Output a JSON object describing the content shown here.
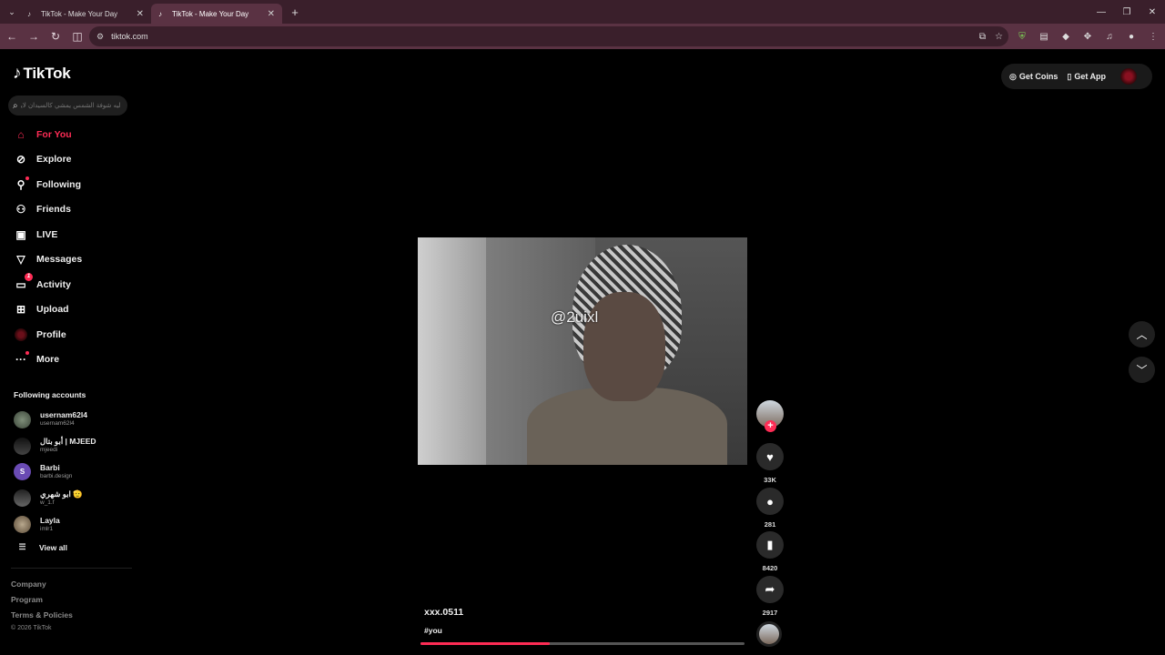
{
  "browser": {
    "tabs": [
      {
        "title": "TikTok - Make Your Day",
        "active": false
      },
      {
        "title": "TikTok - Make Your Day",
        "active": true
      }
    ],
    "new_tab_symbol": "+",
    "address": "tiktok.com",
    "window_controls": {
      "minimize": "—",
      "maximize": "❐",
      "close": "✕"
    }
  },
  "logo": {
    "text": "TikTok",
    "icon": "tiktok-note-icon"
  },
  "search": {
    "placeholder": "ليه شوفة الشمس يمشي كالسيدان لايوه..."
  },
  "nav": [
    {
      "label": "For You",
      "icon": "home-icon",
      "active": true
    },
    {
      "label": "Explore",
      "icon": "compass-icon"
    },
    {
      "label": "Following",
      "icon": "following-icon",
      "dot": true
    },
    {
      "label": "Friends",
      "icon": "friends-icon"
    },
    {
      "label": "LIVE",
      "icon": "live-icon"
    },
    {
      "label": "Messages",
      "icon": "messages-icon"
    },
    {
      "label": "Activity",
      "icon": "activity-icon",
      "badge": "1"
    },
    {
      "label": "Upload",
      "icon": "upload-icon"
    },
    {
      "label": "Profile",
      "icon": "profile-avatar"
    },
    {
      "label": "More",
      "icon": "more-icon",
      "dot": true
    }
  ],
  "following_accounts": {
    "title": "Following accounts",
    "items": [
      {
        "name": "usernam62l4",
        "handle": "usernam62l4"
      },
      {
        "name": "أبو بتال | MJEED",
        "handle": "mjeedi"
      },
      {
        "name": "Barbi",
        "handle": "barbi.design"
      },
      {
        "name": "ابو شهري 🫡",
        "handle": "w_1.f"
      },
      {
        "name": "Layla",
        "handle": "imlr1"
      }
    ],
    "view_all": "View all"
  },
  "footer": {
    "links": [
      "Company",
      "Program",
      "Terms & Policies"
    ],
    "copyright": "© 2026 TikTok"
  },
  "topright": {
    "coins": "Get Coins",
    "app": "Get App"
  },
  "video": {
    "watermark": "@2uixl",
    "author": "xxx.0511",
    "caption": "#you",
    "progress": 0.4,
    "likes": "33K",
    "comments": "281",
    "saves": "8420",
    "shares": "2917"
  },
  "colors": {
    "accent": "#fe2c55",
    "chrome": "#5a3243",
    "tabbar": "#3a1f2b"
  }
}
